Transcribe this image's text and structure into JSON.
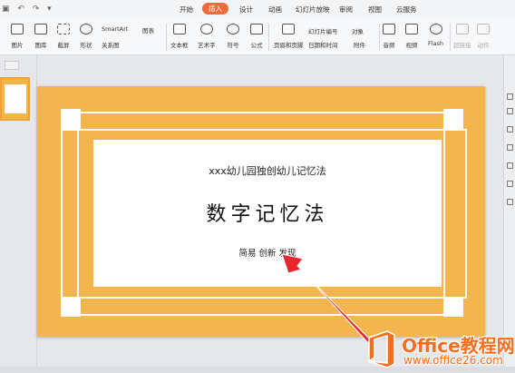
{
  "menu": {
    "tabs": [
      "开始",
      "插入",
      "设计",
      "动画",
      "幻灯片放映",
      "审阅",
      "视图",
      "云服务"
    ],
    "active_tab": "插入"
  },
  "ribbon": {
    "picture": "图片",
    "gallery": "图库",
    "screenshot": "截屏",
    "shape": "形状",
    "smartart": "SmartArt",
    "chart": "图表",
    "relation": "关系图",
    "textbox": "文本框",
    "wordart": "艺术字",
    "symbol": "符号",
    "formula": "公式",
    "header_footer": "页眉和页脚",
    "slide_number": "幻灯片编号",
    "object": "对象",
    "datetime": "日期和时间",
    "attachment": "附件",
    "audio": "音频",
    "video": "视频",
    "flash": "Flash",
    "hyperlink": "超链接",
    "action": "动作"
  },
  "slide": {
    "subtitle": "xxx幼儿园独创幼儿记忆法",
    "title": "数字记忆法",
    "footer": "简易 创新 发现"
  },
  "watermark": {
    "brand": "Office教程网",
    "url": "www.office26.com"
  },
  "colors": {
    "slide_bg": "#f3b64e",
    "active_tab": "#f06b3c",
    "arrow": "#e8262b",
    "watermark": "#f07020"
  }
}
